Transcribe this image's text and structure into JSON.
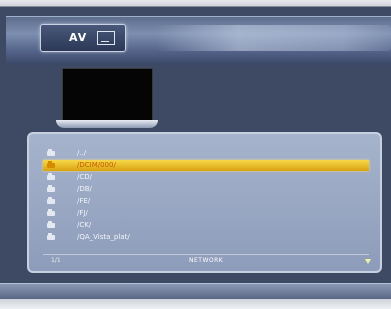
{
  "header": {
    "tab_label": "AV",
    "tab_icon": "video-monitor-icon"
  },
  "file_list": {
    "items": [
      {
        "label": "/../",
        "icon": "folder-icon",
        "selected": false
      },
      {
        "label": "/DCIM/000/",
        "icon": "folder-icon",
        "selected": true
      },
      {
        "label": "/CD/",
        "icon": "folder-icon",
        "selected": false
      },
      {
        "label": "/DB/",
        "icon": "folder-icon",
        "selected": false
      },
      {
        "label": "/FE/",
        "icon": "folder-icon",
        "selected": false
      },
      {
        "label": "/FJ/",
        "icon": "folder-icon",
        "selected": false
      },
      {
        "label": "/CK/",
        "icon": "folder-icon",
        "selected": false
      },
      {
        "label": "/QA_Vista_plat/",
        "icon": "folder-icon",
        "selected": false
      }
    ]
  },
  "footer": {
    "page_number": "1/1",
    "source_label": "NETWORK",
    "scroll_icon": "arrow-down-icon"
  },
  "colors": {
    "background": "#3e4a63",
    "selection": "#f0c838",
    "panel": "#9aa8c4"
  }
}
